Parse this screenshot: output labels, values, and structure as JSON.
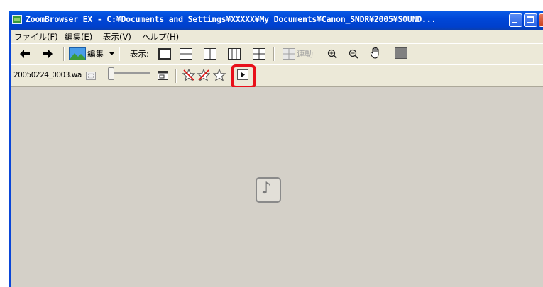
{
  "window": {
    "title": "ZoomBrowser EX - C:¥Documents and Settings¥XXXXX¥My Documents¥Canon_SNDR¥2005¥SOUND..."
  },
  "menu": {
    "items": [
      "ファイル(F)",
      "編集(E)",
      "表示(V)",
      "ヘルプ(H)"
    ]
  },
  "toolbar": {
    "edit_label": "編集",
    "view_label": "表示:",
    "sync_label": "連動"
  },
  "viewer": {
    "filename": "20050224_0003.wa"
  },
  "icons": {
    "back": "back-arrow-icon",
    "forward": "forward-arrow-icon",
    "edit": "edit-image-icon",
    "zoom_in": "zoom-in-icon",
    "zoom_out": "zoom-out-icon",
    "hand": "hand-pan-icon",
    "play": "play-icon",
    "sound": "sound-file-icon"
  },
  "colors": {
    "titlebar": "#0047d8",
    "highlight": "#e8101a",
    "content_bg": "#d4d0c8"
  }
}
